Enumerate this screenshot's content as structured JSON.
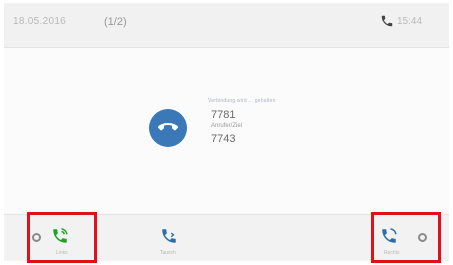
{
  "status_bar": {
    "date": "18.05.2016",
    "page_indicator": "(1/2)",
    "time": "15:44"
  },
  "call": {
    "status_text": "Verbindung wird ... gehalten",
    "number_primary": "7781",
    "secondary_label": "Anrufer/Ziel",
    "number_secondary": "7743"
  },
  "softkeys": [
    {
      "label": "Links",
      "icon": "phone-green-icon",
      "color": "#22a02c"
    },
    {
      "label": "Tausch",
      "icon": "phone-switch-icon",
      "color": "#2e6ea6"
    },
    {
      "label": "Rechts",
      "icon": "phone-blue-icon",
      "color": "#2e6ea6"
    }
  ],
  "colors": {
    "held_call_badge": "#3a78b8",
    "highlight": "#e0101a"
  }
}
